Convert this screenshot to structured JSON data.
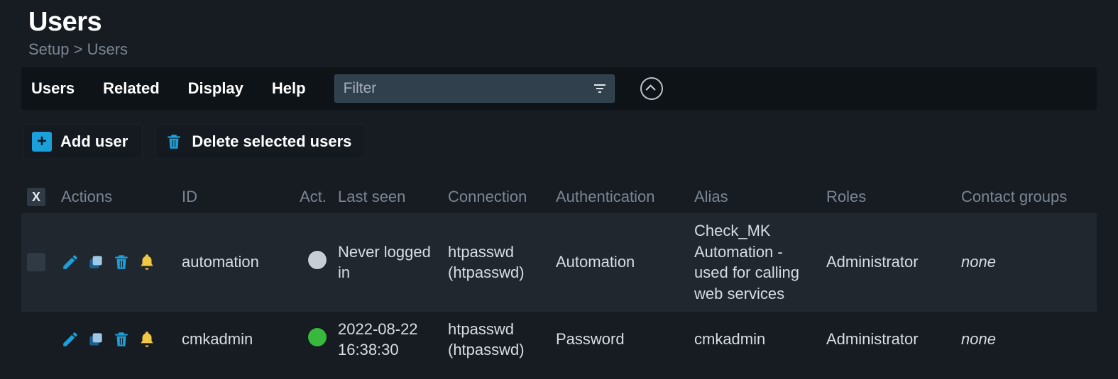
{
  "page": {
    "title": "Users",
    "breadcrumb": "Setup > Users"
  },
  "menu": {
    "users": "Users",
    "related": "Related",
    "display": "Display",
    "help": "Help"
  },
  "filter": {
    "placeholder": "Filter",
    "value": ""
  },
  "actions": {
    "add_user": "Add user",
    "delete_selected": "Delete selected users"
  },
  "table": {
    "select_all_label": "X",
    "headers": {
      "actions": "Actions",
      "id": "ID",
      "act": "Act.",
      "last_seen": "Last seen",
      "connection": "Connection",
      "authentication": "Authentication",
      "alias": "Alias",
      "roles": "Roles",
      "contact_groups": "Contact groups"
    },
    "rows": [
      {
        "id": "automation",
        "status": "gray",
        "last_seen": "Never logged in",
        "connection": "htpasswd (htpasswd)",
        "authentication": "Automation",
        "alias": "Check_MK Automation - used for calling web services",
        "roles": "Administrator",
        "contact_groups": "none"
      },
      {
        "id": "cmkadmin",
        "status": "green",
        "last_seen": "2022-08-22 16:38:30",
        "connection": "htpasswd (htpasswd)",
        "authentication": "Password",
        "alias": "cmkadmin",
        "roles": "Administrator",
        "contact_groups": "none"
      }
    ]
  },
  "colors": {
    "accent_blue": "#1aa1dc",
    "status_green": "#38b93d",
    "status_gray": "#c7cdd4",
    "bell_yellow": "#f2c744"
  }
}
